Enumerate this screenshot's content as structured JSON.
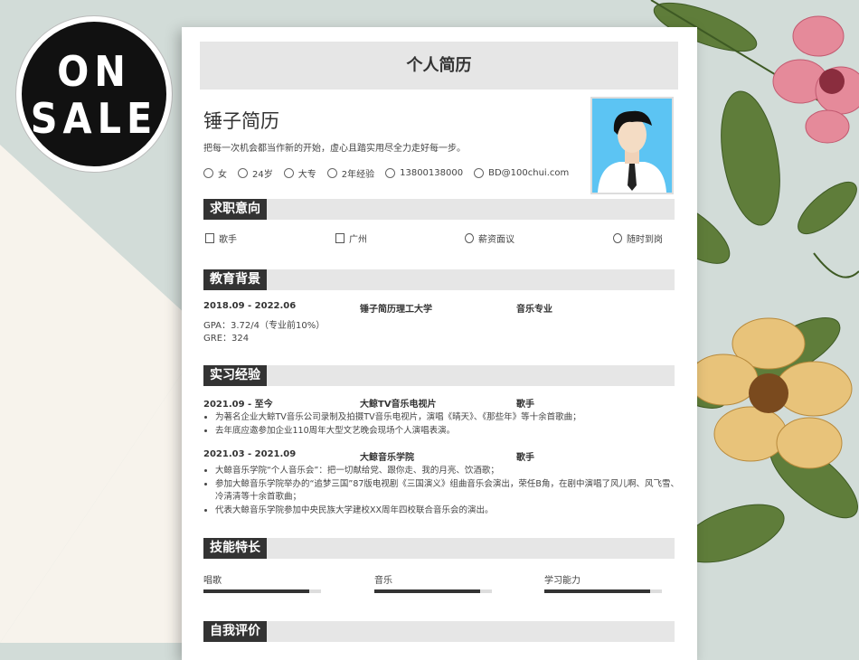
{
  "badge": {
    "line1": "ON",
    "line2": "SALE"
  },
  "resume": {
    "doc_title": "个人简历",
    "name": "锤子简历",
    "motto": "把每一次机会都当作新的开始，虚心且踏实用尽全力走好每一步。",
    "info": [
      {
        "icon": "gender-icon",
        "text": "女"
      },
      {
        "icon": "age-icon",
        "text": "24岁"
      },
      {
        "icon": "degree-icon",
        "text": "大专"
      },
      {
        "icon": "experience-icon",
        "text": "2年经验"
      },
      {
        "icon": "phone-icon",
        "text": "13800138000"
      },
      {
        "icon": "email-icon",
        "text": "BD@100chui.com"
      }
    ],
    "sections": {
      "intent": "求职意向",
      "education": "教育背景",
      "internship": "实习经验",
      "skills": "技能特长",
      "self": "自我评价"
    },
    "intent": [
      {
        "icon": "job-icon",
        "text": "歌手"
      },
      {
        "icon": "city-icon",
        "text": "广州"
      },
      {
        "icon": "salary-icon",
        "text": "薪资面议"
      },
      {
        "icon": "clock-icon",
        "text": "随时到岗"
      }
    ],
    "education": {
      "period": "2018.09 - 2022.06",
      "school": "锤子简历理工大学",
      "major": "音乐专业",
      "gpa": "GPA：3.72/4（专业前10%）",
      "gre": "GRE：324"
    },
    "jobs": [
      {
        "period": "2021.09 - 至今",
        "company": "大鲸TV音乐电视片",
        "role": "歌手",
        "bullets": [
          "为著名企业大鲸TV音乐公司录制及拍摄TV音乐电视片，演唱《晴天》、《那些年》等十余首歌曲；",
          "去年底应邀参加企业110周年大型文艺晚会现场个人演唱表演。"
        ]
      },
      {
        "period": "2021.03 - 2021.09",
        "company": "大鲸音乐学院",
        "role": "歌手",
        "bullets": [
          "大鲸音乐学院“个人音乐会”：把一切献给党、跟你走、我的月亮、饮酒歌；",
          "参加大鲸音乐学院举办的“追梦三国”87版电视剧《三国演义》组曲音乐会演出，荣任B角，在剧中演唱了风儿啊、风飞雪、冷清清等十余首歌曲；",
          "代表大鲸音乐学院参加中央民族大学建校XX周年四校联合音乐会的演出。"
        ]
      }
    ],
    "skills": [
      {
        "name": "唱歌",
        "level": 0.9
      },
      {
        "name": "音乐",
        "level": 0.9
      },
      {
        "name": "学习能力",
        "level": 0.9
      }
    ]
  }
}
